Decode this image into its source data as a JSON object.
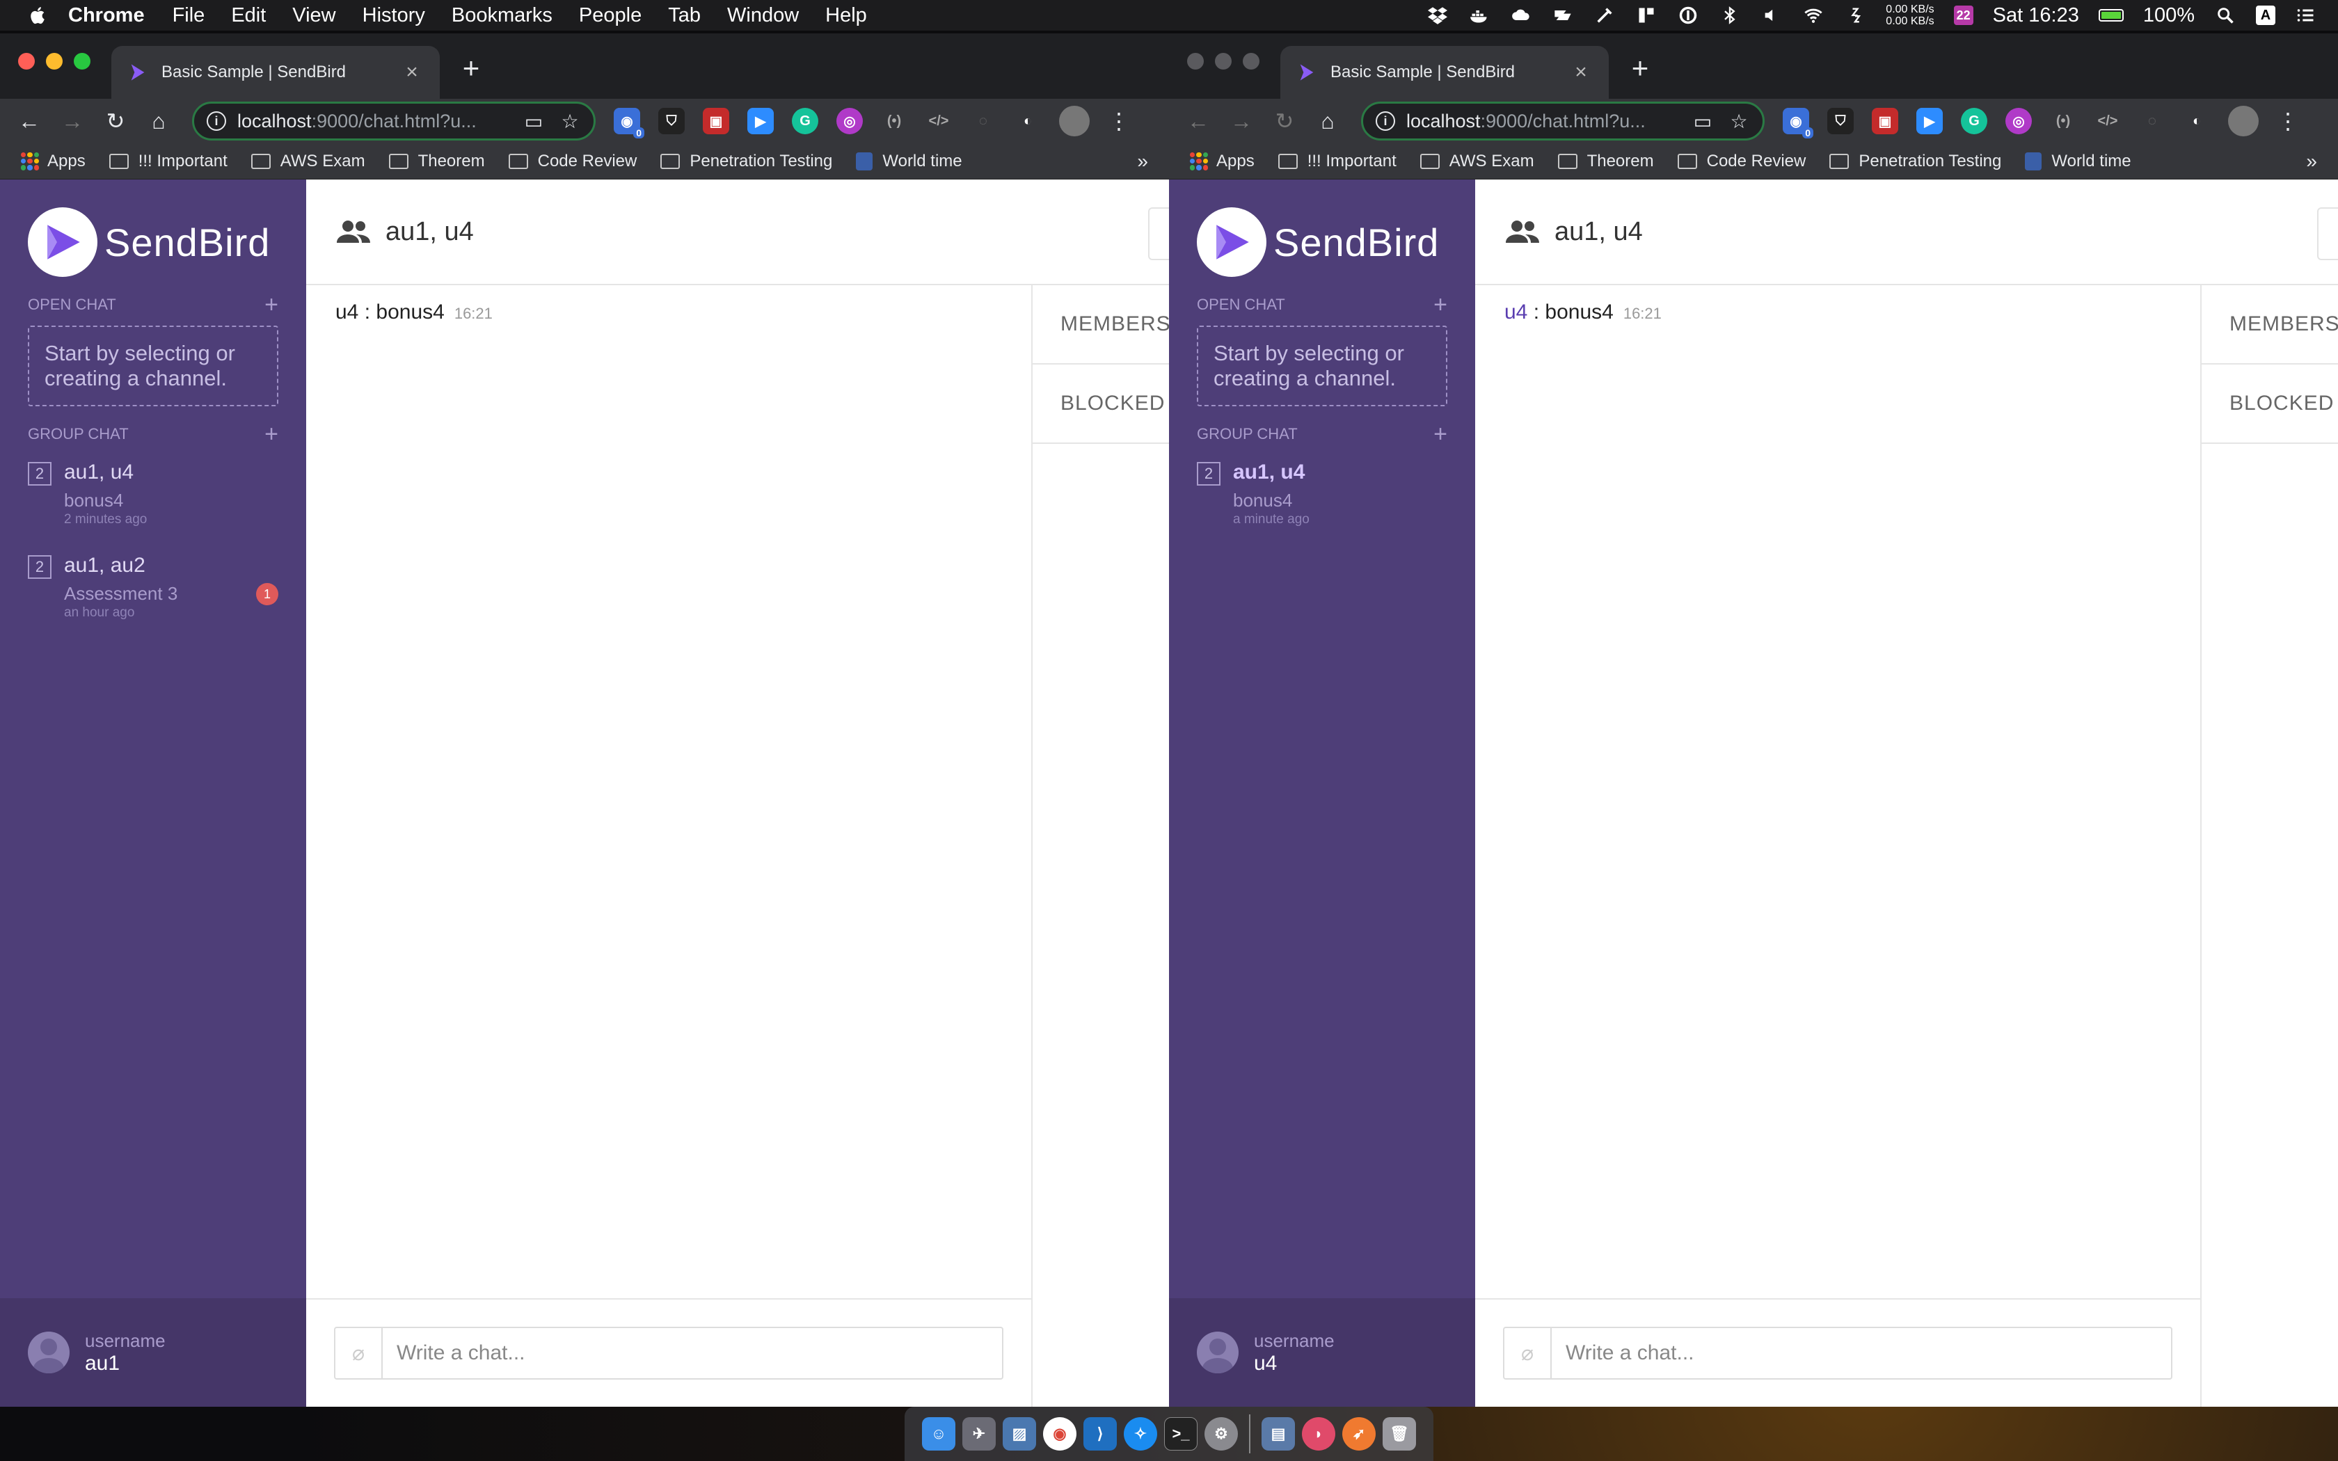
{
  "menubar": {
    "app_name": "Chrome",
    "items": [
      "File",
      "Edit",
      "View",
      "History",
      "Bookmarks",
      "People",
      "Tab",
      "Window",
      "Help"
    ],
    "status": {
      "net_up": "0.00 KB/s",
      "net_down": "0.00 KB/s",
      "calendar_day": "22",
      "clock": "Sat 16:23",
      "battery": "100%",
      "battery_level": 1.0,
      "input_source": "A"
    }
  },
  "browser": {
    "tab_title": "Basic Sample | SendBird",
    "url_host": "localhost",
    "url_rest": ":9000/chat.html?u...",
    "bookmarks": [
      "Apps",
      "!!! Important",
      "AWS Exam",
      "Theorem",
      "Code Review",
      "Penetration Testing",
      "World time"
    ],
    "bookmarks_more": "»",
    "ext_badge": "0"
  },
  "app": {
    "logo_text": "SendBird",
    "open_chat_label": "OPEN CHAT",
    "group_chat_label": "GROUP CHAT",
    "empty_open_chat": "Start by selecting or creating a channel.",
    "chat_title": "au1, u4",
    "members_tab": "MEMBERS",
    "blocked_tab": "BLOCKED",
    "composer_placeholder": "Write a chat...",
    "username_label": "username"
  },
  "left_window": {
    "channels": [
      {
        "count": "2",
        "name": "au1, u4",
        "last": "bonus4",
        "time": "2 minutes ago"
      },
      {
        "count": "2",
        "name": "au1, au2",
        "last": "Assessment 3",
        "time": "an hour ago",
        "unread": "1"
      }
    ],
    "message": {
      "sender": "u4",
      "sep": " : ",
      "text": "bonus4",
      "time": "16:21"
    },
    "username": "au1"
  },
  "right_window": {
    "channels": [
      {
        "count": "2",
        "name": "au1, u4",
        "last": "bonus4",
        "time": "a minute ago"
      }
    ],
    "message": {
      "sender": "u4",
      "sep": " : ",
      "text": "bonus4",
      "time": "16:21"
    },
    "username": "u4"
  },
  "colors": {
    "sidebar": "#4e3e78",
    "sidebar_footer": "#453668",
    "accent": "#5a3eb0",
    "badge": "#e05a5a",
    "omnibox_border": "#2a7a44"
  }
}
